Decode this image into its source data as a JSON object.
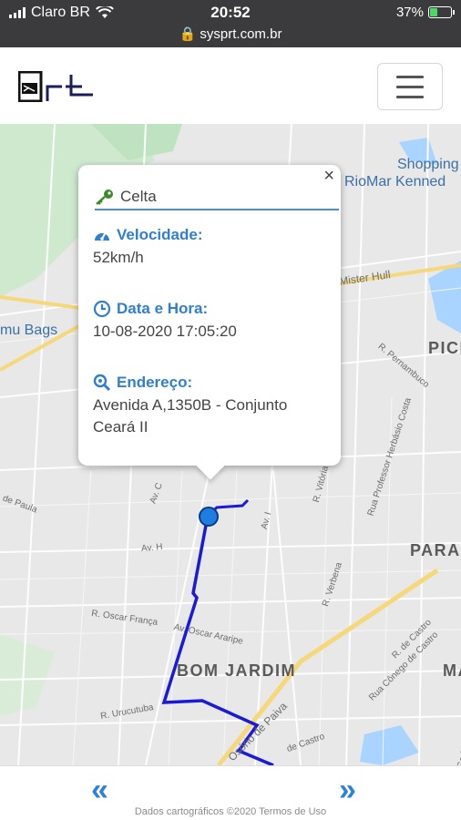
{
  "status_bar": {
    "carrier": "Claro BR",
    "time": "20:52",
    "battery": "37%",
    "battery_level": 0.37,
    "url": "sysprt.com.br"
  },
  "navbar": {
    "logo_text": "PRT",
    "menu_icon": "hamburger-icon"
  },
  "map": {
    "labels": {
      "shopping_1": "Shopping",
      "shopping_2": "RioMar Kenned",
      "mister_hull": "Mister Hull",
      "mu_bags": "mu Bags",
      "pici": "PICI",
      "parangaba": "PARA",
      "bom_jardim": "BOM JARDIM",
      "ma": "MA",
      "r_pernambuco": "R. Pernambuco",
      "rua_prof": "Rua Professor Herbásio Costa",
      "r_vitoria": "R. Vitória",
      "r_verbena": "R. Verbena",
      "av_c": "Av. C",
      "av_h": "Av. H",
      "av_i": "Av. I",
      "de_paula": "de Paula",
      "r_oscar_franca": "R. Oscar França",
      "av_oscar_araripe": "Av. Oscar Araripe",
      "r_urucutuba": "R. Urucutuba",
      "osorio_de_paiva": "Osório de Paiva",
      "rua_conego": "Rua Cônego de Castro",
      "r_godofredo": "R. Godofredo Maciel",
      "de_castro": "de Castro",
      "r_de_castro": "R. de Castro"
    },
    "route_color": "#1a1ad8",
    "marker_color": "#1e7ee0"
  },
  "popup": {
    "close_label": "×",
    "vehicle": "Celta",
    "speed_title": "Velocidade:",
    "speed_value": "52km/h",
    "datetime_title": "Data e Hora:",
    "datetime_value": "10-08-2020 17:05:20",
    "address_title": "Endereço:",
    "address_value": "Avenida A,1350B - Conjunto Ceará II",
    "accent_color": "#2f7fd0"
  },
  "footer": {
    "prev_label": "«",
    "next_label": "»",
    "credits": "Dados cartográficos ©2020    Termos de Uso"
  }
}
